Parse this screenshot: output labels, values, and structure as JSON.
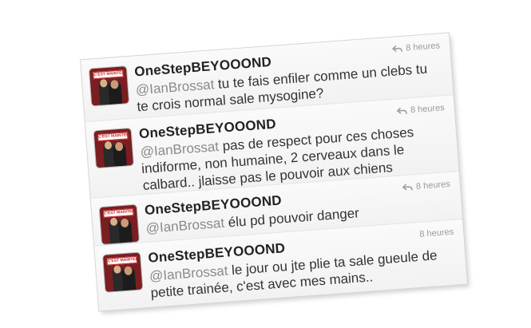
{
  "tweets": [
    {
      "username": "OneStepBEYOOOND",
      "mention": "@IanBrossat",
      "text": " tu te fais enfiler comme un clebs tu te crois normal sale mysogine?",
      "time": "8 heures",
      "show_reply_icon": true,
      "avatar_banner": "C'EST MAINTENANT"
    },
    {
      "username": "OneStepBEYOOOND",
      "mention": "@IanBrossat",
      "text": " pas de respect pour ces choses indiforme, non humaine, 2 cerveaux dans le calbard.. jlaisse pas le pouvoir aux chiens",
      "time": "8 heures",
      "show_reply_icon": true,
      "avatar_banner": "C'EST MAINTENANT"
    },
    {
      "username": "OneStepBEYOOOND",
      "mention": "@IanBrossat",
      "text": " élu pd pouvoir danger",
      "time": "8 heures",
      "show_reply_icon": true,
      "avatar_banner": "C'EST MAINTENANT"
    },
    {
      "username": "OneStepBEYOOOND",
      "mention": "@IanBrossat",
      "text": " le jour ou jte plie ta sale gueule de petite trainée, c'est avec mes mains..",
      "time": "8 heures",
      "show_reply_icon": false,
      "avatar_banner": "C'EST MAINTENANT"
    }
  ]
}
